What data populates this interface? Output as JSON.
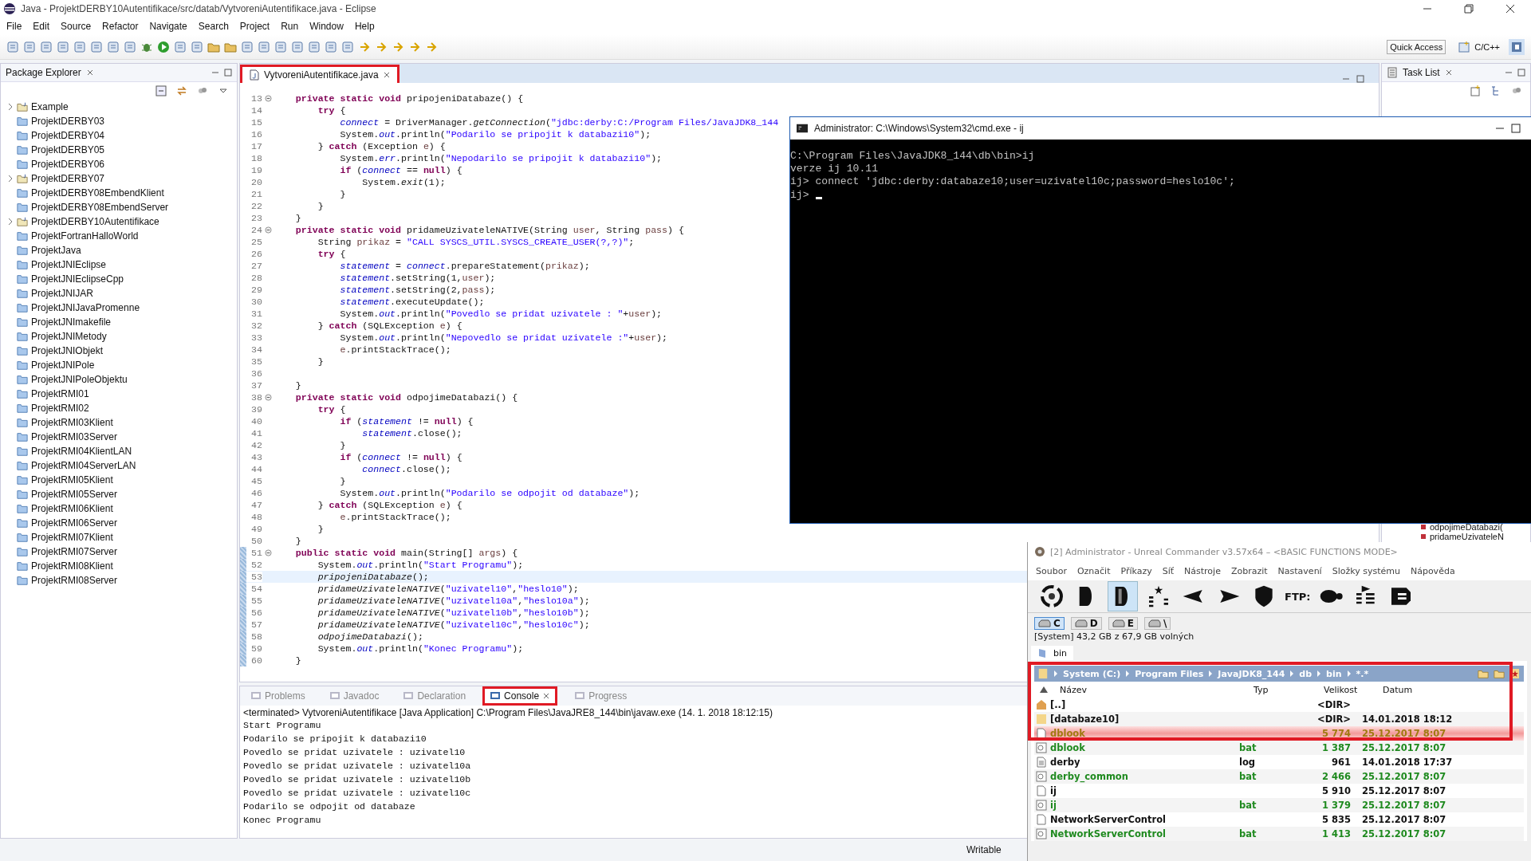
{
  "window": {
    "title": "Java - ProjektDERBY10Autentifikace/src/datab/VytvoreniAutentifikace.java - Eclipse"
  },
  "menu": [
    "File",
    "Edit",
    "Source",
    "Refactor",
    "Navigate",
    "Search",
    "Project",
    "Run",
    "Window",
    "Help"
  ],
  "toolbar": {
    "quick_access": "Quick Access",
    "perspective": "C/C++"
  },
  "package_explorer": {
    "title": "Package Explorer",
    "projects": [
      {
        "name": "Example",
        "kind": "java"
      },
      {
        "name": "ProjektDERBY03",
        "kind": "plain"
      },
      {
        "name": "ProjektDERBY04",
        "kind": "plain"
      },
      {
        "name": "ProjektDERBY05",
        "kind": "plain"
      },
      {
        "name": "ProjektDERBY06",
        "kind": "plain"
      },
      {
        "name": "ProjektDERBY07",
        "kind": "java"
      },
      {
        "name": "ProjektDERBY08EmbendKlient",
        "kind": "plain"
      },
      {
        "name": "ProjektDERBY08EmbendServer",
        "kind": "plain"
      },
      {
        "name": "ProjektDERBY10Autentifikace",
        "kind": "java"
      },
      {
        "name": "ProjektFortranHalloWorld",
        "kind": "plain"
      },
      {
        "name": "ProjektJava",
        "kind": "plain"
      },
      {
        "name": "ProjektJNIEclipse",
        "kind": "plain"
      },
      {
        "name": "ProjektJNIEclipseCpp",
        "kind": "plain"
      },
      {
        "name": "ProjektJNIJAR",
        "kind": "plain"
      },
      {
        "name": "ProjektJNIJavaPromenne",
        "kind": "plain"
      },
      {
        "name": "ProjektJNImakefile",
        "kind": "plain"
      },
      {
        "name": "ProjektJNIMetody",
        "kind": "plain"
      },
      {
        "name": "ProjektJNIObjekt",
        "kind": "plain"
      },
      {
        "name": "ProjektJNIPole",
        "kind": "plain"
      },
      {
        "name": "ProjektJNIPoleObjektu",
        "kind": "plain"
      },
      {
        "name": "ProjektRMI01",
        "kind": "plain"
      },
      {
        "name": "ProjektRMI02",
        "kind": "plain"
      },
      {
        "name": "ProjektRMI03Klient",
        "kind": "plain"
      },
      {
        "name": "ProjektRMI03Server",
        "kind": "plain"
      },
      {
        "name": "ProjektRMI04KlientLAN",
        "kind": "plain"
      },
      {
        "name": "ProjektRMI04ServerLAN",
        "kind": "plain"
      },
      {
        "name": "ProjektRMI05Klient",
        "kind": "plain"
      },
      {
        "name": "ProjektRMI05Server",
        "kind": "plain"
      },
      {
        "name": "ProjektRMI06Klient",
        "kind": "plain"
      },
      {
        "name": "ProjektRMI06Server",
        "kind": "plain"
      },
      {
        "name": "ProjektRMI07Klient",
        "kind": "plain"
      },
      {
        "name": "ProjektRMI07Server",
        "kind": "plain"
      },
      {
        "name": "ProjektRMI08Klient",
        "kind": "plain"
      },
      {
        "name": "ProjektRMI08Server",
        "kind": "plain"
      }
    ]
  },
  "editor": {
    "tab": {
      "label": "VytvoreniAutentifikace.java",
      "annotated": true
    },
    "lines": [
      {
        "no": "13",
        "fold": true,
        "changed": false,
        "current": false,
        "tokens": [
          {
            "kind": "k",
            "text": "    private static void"
          },
          {
            "kind": "p",
            "text": " pripojeniDatabaze() {"
          }
        ]
      },
      {
        "no": "14",
        "fold": false,
        "changed": false,
        "current": false,
        "tokens": [
          {
            "kind": "k",
            "text": "        try"
          },
          {
            "kind": "p",
            "text": " {"
          }
        ]
      },
      {
        "no": "15",
        "fold": false,
        "changed": false,
        "current": false,
        "tokens": [
          {
            "kind": "f",
            "text": "            connect"
          },
          {
            "kind": "p",
            "text": " = DriverManager."
          },
          {
            "kind": "i",
            "text": "getConnection"
          },
          {
            "kind": "p",
            "text": "("
          },
          {
            "kind": "s",
            "text": "\"jdbc:derby:C:/Program Files/JavaJDK8_144"
          }
        ]
      },
      {
        "no": "16",
        "fold": false,
        "changed": false,
        "current": false,
        "tokens": [
          {
            "kind": "p",
            "text": "            System."
          },
          {
            "kind": "f",
            "text": "out"
          },
          {
            "kind": "p",
            "text": ".println("
          },
          {
            "kind": "s",
            "text": "\"Podarilo se pripojit k databazi10\""
          },
          {
            "kind": "p",
            "text": ");"
          }
        ]
      },
      {
        "no": "17",
        "fold": false,
        "changed": false,
        "current": false,
        "tokens": [
          {
            "kind": "p",
            "text": "        } "
          },
          {
            "kind": "k",
            "text": "catch"
          },
          {
            "kind": "p",
            "text": " (Exception "
          },
          {
            "kind": "v",
            "text": "e"
          },
          {
            "kind": "p",
            "text": ") {"
          }
        ]
      },
      {
        "no": "18",
        "fold": false,
        "changed": false,
        "current": false,
        "tokens": [
          {
            "kind": "p",
            "text": "            System."
          },
          {
            "kind": "f",
            "text": "err"
          },
          {
            "kind": "p",
            "text": ".println("
          },
          {
            "kind": "s",
            "text": "\"Nepodarilo se pripojit k databazi10\""
          },
          {
            "kind": "p",
            "text": ");"
          }
        ]
      },
      {
        "no": "19",
        "fold": false,
        "changed": false,
        "current": false,
        "tokens": [
          {
            "kind": "k",
            "text": "            if"
          },
          {
            "kind": "p",
            "text": " ("
          },
          {
            "kind": "f",
            "text": "connect"
          },
          {
            "kind": "p",
            "text": " == "
          },
          {
            "kind": "k",
            "text": "null"
          },
          {
            "kind": "p",
            "text": ") {"
          }
        ]
      },
      {
        "no": "20",
        "fold": false,
        "changed": false,
        "current": false,
        "tokens": [
          {
            "kind": "p",
            "text": "                System."
          },
          {
            "kind": "i",
            "text": "exit"
          },
          {
            "kind": "p",
            "text": "(1);"
          }
        ]
      },
      {
        "no": "21",
        "fold": false,
        "changed": false,
        "current": false,
        "tokens": [
          {
            "kind": "p",
            "text": "            }"
          }
        ]
      },
      {
        "no": "22",
        "fold": false,
        "changed": false,
        "current": false,
        "tokens": [
          {
            "kind": "p",
            "text": "        }"
          }
        ]
      },
      {
        "no": "23",
        "fold": false,
        "changed": false,
        "current": false,
        "tokens": [
          {
            "kind": "p",
            "text": "    }"
          }
        ]
      },
      {
        "no": "24",
        "fold": true,
        "changed": false,
        "current": false,
        "tokens": [
          {
            "kind": "k",
            "text": "    private static void"
          },
          {
            "kind": "p",
            "text": " pridameUzivateleNATIVE(String "
          },
          {
            "kind": "v",
            "text": "user"
          },
          {
            "kind": "p",
            "text": ", String "
          },
          {
            "kind": "v",
            "text": "pass"
          },
          {
            "kind": "p",
            "text": ") {"
          }
        ]
      },
      {
        "no": "25",
        "fold": false,
        "changed": false,
        "current": false,
        "tokens": [
          {
            "kind": "p",
            "text": "        String "
          },
          {
            "kind": "v",
            "text": "prikaz"
          },
          {
            "kind": "p",
            "text": " = "
          },
          {
            "kind": "s",
            "text": "\"CALL SYSCS_UTIL.SYSCS_CREATE_USER(?,?)\""
          },
          {
            "kind": "p",
            "text": ";"
          }
        ]
      },
      {
        "no": "26",
        "fold": false,
        "changed": false,
        "current": false,
        "tokens": [
          {
            "kind": "k",
            "text": "        try"
          },
          {
            "kind": "p",
            "text": " {"
          }
        ]
      },
      {
        "no": "27",
        "fold": false,
        "changed": false,
        "current": false,
        "tokens": [
          {
            "kind": "f",
            "text": "            statement"
          },
          {
            "kind": "p",
            "text": " = "
          },
          {
            "kind": "f",
            "text": "connect"
          },
          {
            "kind": "p",
            "text": ".prepareStatement("
          },
          {
            "kind": "v",
            "text": "prikaz"
          },
          {
            "kind": "p",
            "text": ");"
          }
        ]
      },
      {
        "no": "28",
        "fold": false,
        "changed": false,
        "current": false,
        "tokens": [
          {
            "kind": "f",
            "text": "            statement"
          },
          {
            "kind": "p",
            "text": ".setString(1,"
          },
          {
            "kind": "v",
            "text": "user"
          },
          {
            "kind": "p",
            "text": ");"
          }
        ]
      },
      {
        "no": "29",
        "fold": false,
        "changed": false,
        "current": false,
        "tokens": [
          {
            "kind": "f",
            "text": "            statement"
          },
          {
            "kind": "p",
            "text": ".setString(2,"
          },
          {
            "kind": "v",
            "text": "pass"
          },
          {
            "kind": "p",
            "text": ");"
          }
        ]
      },
      {
        "no": "30",
        "fold": false,
        "changed": false,
        "current": false,
        "tokens": [
          {
            "kind": "f",
            "text": "            statement"
          },
          {
            "kind": "p",
            "text": ".executeUpdate();"
          }
        ]
      },
      {
        "no": "31",
        "fold": false,
        "changed": false,
        "current": false,
        "tokens": [
          {
            "kind": "p",
            "text": "            System."
          },
          {
            "kind": "f",
            "text": "out"
          },
          {
            "kind": "p",
            "text": ".println("
          },
          {
            "kind": "s",
            "text": "\"Povedlo se pridat uzivatele : \""
          },
          {
            "kind": "p",
            "text": "+"
          },
          {
            "kind": "v",
            "text": "user"
          },
          {
            "kind": "p",
            "text": ");"
          }
        ]
      },
      {
        "no": "32",
        "fold": false,
        "changed": false,
        "current": false,
        "tokens": [
          {
            "kind": "p",
            "text": "        } "
          },
          {
            "kind": "k",
            "text": "catch"
          },
          {
            "kind": "p",
            "text": " (SQLException "
          },
          {
            "kind": "v",
            "text": "e"
          },
          {
            "kind": "p",
            "text": ") {"
          }
        ]
      },
      {
        "no": "33",
        "fold": false,
        "changed": false,
        "current": false,
        "tokens": [
          {
            "kind": "p",
            "text": "            System."
          },
          {
            "kind": "f",
            "text": "out"
          },
          {
            "kind": "p",
            "text": ".println("
          },
          {
            "kind": "s",
            "text": "\"Nepovedlo se pridat uzivatele :\""
          },
          {
            "kind": "p",
            "text": "+"
          },
          {
            "kind": "v",
            "text": "user"
          },
          {
            "kind": "p",
            "text": ");"
          }
        ]
      },
      {
        "no": "34",
        "fold": false,
        "changed": false,
        "current": false,
        "tokens": [
          {
            "kind": "v",
            "text": "            e"
          },
          {
            "kind": "p",
            "text": ".printStackTrace();"
          }
        ]
      },
      {
        "no": "35",
        "fold": false,
        "changed": false,
        "current": false,
        "tokens": [
          {
            "kind": "p",
            "text": "        }"
          }
        ]
      },
      {
        "no": "36",
        "fold": false,
        "changed": false,
        "current": false
      },
      {
        "no": "37",
        "fold": false,
        "changed": false,
        "current": false,
        "tokens": [
          {
            "kind": "p",
            "text": "    }"
          }
        ]
      },
      {
        "no": "38",
        "fold": true,
        "changed": false,
        "current": false,
        "tokens": [
          {
            "kind": "k",
            "text": "    private static void"
          },
          {
            "kind": "p",
            "text": " odpojimeDatabazi() {"
          }
        ]
      },
      {
        "no": "39",
        "fold": false,
        "changed": false,
        "current": false,
        "tokens": [
          {
            "kind": "k",
            "text": "        try"
          },
          {
            "kind": "p",
            "text": " {"
          }
        ]
      },
      {
        "no": "40",
        "fold": false,
        "changed": false,
        "current": false,
        "tokens": [
          {
            "kind": "k",
            "text": "            if"
          },
          {
            "kind": "p",
            "text": " ("
          },
          {
            "kind": "f",
            "text": "statement"
          },
          {
            "kind": "p",
            "text": " != "
          },
          {
            "kind": "k",
            "text": "null"
          },
          {
            "kind": "p",
            "text": ") {"
          }
        ]
      },
      {
        "no": "41",
        "fold": false,
        "changed": false,
        "current": false,
        "tokens": [
          {
            "kind": "f",
            "text": "                statement"
          },
          {
            "kind": "p",
            "text": ".close();"
          }
        ]
      },
      {
        "no": "42",
        "fold": false,
        "changed": false,
        "current": false,
        "tokens": [
          {
            "kind": "p",
            "text": "            }"
          }
        ]
      },
      {
        "no": "43",
        "fold": false,
        "changed": false,
        "current": false,
        "tokens": [
          {
            "kind": "k",
            "text": "            if"
          },
          {
            "kind": "p",
            "text": " ("
          },
          {
            "kind": "f",
            "text": "connect"
          },
          {
            "kind": "p",
            "text": " != "
          },
          {
            "kind": "k",
            "text": "null"
          },
          {
            "kind": "p",
            "text": ") {"
          }
        ]
      },
      {
        "no": "44",
        "fold": false,
        "changed": false,
        "current": false,
        "tokens": [
          {
            "kind": "f",
            "text": "                connect"
          },
          {
            "kind": "p",
            "text": ".close();"
          }
        ]
      },
      {
        "no": "45",
        "fold": false,
        "changed": false,
        "current": false,
        "tokens": [
          {
            "kind": "p",
            "text": "            }"
          }
        ]
      },
      {
        "no": "46",
        "fold": false,
        "changed": false,
        "current": false,
        "tokens": [
          {
            "kind": "p",
            "text": "            System."
          },
          {
            "kind": "f",
            "text": "out"
          },
          {
            "kind": "p",
            "text": ".println("
          },
          {
            "kind": "s",
            "text": "\"Podarilo se odpojit od databaze\""
          },
          {
            "kind": "p",
            "text": ");"
          }
        ]
      },
      {
        "no": "47",
        "fold": false,
        "changed": false,
        "current": false,
        "tokens": [
          {
            "kind": "p",
            "text": "        } "
          },
          {
            "kind": "k",
            "text": "catch"
          },
          {
            "kind": "p",
            "text": " (SQLException "
          },
          {
            "kind": "v",
            "text": "e"
          },
          {
            "kind": "p",
            "text": ") {"
          }
        ]
      },
      {
        "no": "48",
        "fold": false,
        "changed": false,
        "current": false,
        "tokens": [
          {
            "kind": "v",
            "text": "            e"
          },
          {
            "kind": "p",
            "text": ".printStackTrace();"
          }
        ]
      },
      {
        "no": "49",
        "fold": false,
        "changed": false,
        "current": false,
        "tokens": [
          {
            "kind": "p",
            "text": "        }"
          }
        ]
      },
      {
        "no": "50",
        "fold": false,
        "changed": false,
        "current": false,
        "tokens": [
          {
            "kind": "p",
            "text": "    }"
          }
        ]
      },
      {
        "no": "51",
        "fold": true,
        "changed": true,
        "current": false,
        "tokens": [
          {
            "kind": "k",
            "text": "    public static void"
          },
          {
            "kind": "p",
            "text": " main(String[] "
          },
          {
            "kind": "v",
            "text": "args"
          },
          {
            "kind": "p",
            "text": ") {"
          }
        ]
      },
      {
        "no": "52",
        "fold": false,
        "changed": true,
        "current": false,
        "tokens": [
          {
            "kind": "p",
            "text": "        System."
          },
          {
            "kind": "f",
            "text": "out"
          },
          {
            "kind": "p",
            "text": ".println("
          },
          {
            "kind": "s",
            "text": "\"Start Programu\""
          },
          {
            "kind": "p",
            "text": ");"
          }
        ]
      },
      {
        "no": "53",
        "fold": false,
        "changed": true,
        "current": true,
        "tokens": [
          {
            "kind": "i",
            "text": "        pripojeniDatabaze"
          },
          {
            "kind": "p",
            "text": "();"
          }
        ]
      },
      {
        "no": "54",
        "fold": false,
        "changed": true,
        "current": false,
        "tokens": [
          {
            "kind": "i",
            "text": "        pridameUzivateleNATIVE"
          },
          {
            "kind": "p",
            "text": "("
          },
          {
            "kind": "s",
            "text": "\"uzivatel10\""
          },
          {
            "kind": "p",
            "text": ","
          },
          {
            "kind": "s",
            "text": "\"heslo10\""
          },
          {
            "kind": "p",
            "text": ");"
          }
        ]
      },
      {
        "no": "55",
        "fold": false,
        "changed": true,
        "current": false,
        "tokens": [
          {
            "kind": "i",
            "text": "        pridameUzivateleNATIVE"
          },
          {
            "kind": "p",
            "text": "("
          },
          {
            "kind": "s",
            "text": "\"uzivatel10a\""
          },
          {
            "kind": "p",
            "text": ","
          },
          {
            "kind": "s",
            "text": "\"heslo10a\""
          },
          {
            "kind": "p",
            "text": ");"
          }
        ]
      },
      {
        "no": "56",
        "fold": false,
        "changed": true,
        "current": false,
        "tokens": [
          {
            "kind": "i",
            "text": "        pridameUzivateleNATIVE"
          },
          {
            "kind": "p",
            "text": "("
          },
          {
            "kind": "s",
            "text": "\"uzivatel10b\""
          },
          {
            "kind": "p",
            "text": ","
          },
          {
            "kind": "s",
            "text": "\"heslo10b\""
          },
          {
            "kind": "p",
            "text": ");"
          }
        ]
      },
      {
        "no": "57",
        "fold": false,
        "changed": true,
        "current": false,
        "tokens": [
          {
            "kind": "i",
            "text": "        pridameUzivateleNATIVE"
          },
          {
            "kind": "p",
            "text": "("
          },
          {
            "kind": "s",
            "text": "\"uzivatel10c\""
          },
          {
            "kind": "p",
            "text": ","
          },
          {
            "kind": "s",
            "text": "\"heslo10c\""
          },
          {
            "kind": "p",
            "text": ");"
          }
        ]
      },
      {
        "no": "58",
        "fold": false,
        "changed": true,
        "current": false,
        "tokens": [
          {
            "kind": "i",
            "text": "        odpojimeDatabazi"
          },
          {
            "kind": "p",
            "text": "();"
          }
        ]
      },
      {
        "no": "59",
        "fold": false,
        "changed": true,
        "current": false,
        "tokens": [
          {
            "kind": "p",
            "text": "        System."
          },
          {
            "kind": "f",
            "text": "out"
          },
          {
            "kind": "p",
            "text": ".println("
          },
          {
            "kind": "s",
            "text": "\"Konec Programu\""
          },
          {
            "kind": "p",
            "text": ");"
          }
        ]
      },
      {
        "no": "60",
        "fold": false,
        "changed": true,
        "current": false,
        "tokens": [
          {
            "kind": "p",
            "text": "    }"
          }
        ]
      }
    ]
  },
  "task_list": {
    "title": "Task List",
    "outline": [
      "odpojimeDatabazi(",
      "pridameUzivateleN"
    ]
  },
  "bottom_panel": {
    "tabs": [
      {
        "label": "Problems",
        "selected": false,
        "annotated": false
      },
      {
        "label": "Javadoc",
        "selected": false,
        "annotated": false
      },
      {
        "label": "Declaration",
        "selected": false,
        "annotated": false
      },
      {
        "label": "Console",
        "selected": true,
        "annotated": true
      },
      {
        "label": "Progress",
        "selected": false,
        "annotated": false
      }
    ],
    "console_header": "<terminated> VytvoreniAutentifikace [Java Application] C:\\Program Files\\JavaJRE8_144\\bin\\javaw.exe (14. 1. 2018 18:12:15)",
    "console_lines": [
      "Start Programu",
      "Podarilo se pripojit k databazi10",
      "Povedlo se pridat uzivatele : uzivatel10",
      "Povedlo se pridat uzivatele : uzivatel10a",
      "Povedlo se pridat uzivatele : uzivatel10b",
      "Povedlo se pridat uzivatele : uzivatel10c",
      "Podarilo se odpojit od databaze",
      "Konec Programu"
    ]
  },
  "status_bar": {
    "mode": "Writable"
  },
  "cmd_window": {
    "title": "Administrator: C:\\Windows\\System32\\cmd.exe - ij",
    "lines": [
      "C:\\Program Files\\JavaJDK8_144\\db\\bin>ij",
      "verze ij 10.11",
      "ij> connect 'jdbc:derby:databaze10;user=uzivatel10c;password=heslo10c';",
      "ij>"
    ]
  },
  "commander": {
    "title": "[2] Administrator - Unreal Commander v3.57x64 – <BASIC FUNCTIONS MODE>",
    "menu": [
      "Soubor",
      "Označit",
      "Příkazy",
      "Síť",
      "Nástroje",
      "Zobrazit",
      "Nastavení",
      "Složky systému",
      "Nápověda"
    ],
    "ftp_label": "FTP:",
    "drives": [
      {
        "label": "C",
        "selected": true
      },
      {
        "label": "D",
        "selected": false
      },
      {
        "label": "E",
        "selected": false
      },
      {
        "label": "\\",
        "selected": false
      }
    ],
    "disk_info": "[System]  43,2 GB z  67,9 GB volných",
    "folder_tab": "bin",
    "path": [
      "System (C:)",
      "Program Files",
      "JavaJDK8_144",
      "db",
      "bin",
      "*.*"
    ],
    "annotated": true,
    "columns": [
      "Název",
      "Typ",
      "Velikost",
      "Datum"
    ],
    "files": [
      {
        "name": "[..]",
        "kind": "up",
        "size": "<DIR>",
        "selected": false
      },
      {
        "name": "[databaze10]",
        "kind": "dir",
        "size": "<DIR>",
        "date": "14.01.2018 18:12",
        "selected": false
      },
      {
        "name": "dblook",
        "kind": "file",
        "size": "5 774",
        "date": "25.12.2017 8:07",
        "selected": true
      },
      {
        "name": "dblook",
        "kind": "bat",
        "type": "bat",
        "size": "1 387",
        "date": "25.12.2017 8:07",
        "selected": false
      },
      {
        "name": "derby",
        "kind": "log",
        "type": "log",
        "size": "961",
        "date": "14.01.2018 17:37",
        "selected": false
      },
      {
        "name": "derby_common",
        "kind": "bat",
        "type": "bat",
        "size": "2 466",
        "date": "25.12.2017 8:07",
        "selected": false
      },
      {
        "name": "ij",
        "kind": "file",
        "size": "5 910",
        "date": "25.12.2017 8:07",
        "selected": false
      },
      {
        "name": "ij",
        "kind": "bat",
        "type": "bat",
        "size": "1 379",
        "date": "25.12.2017 8:07",
        "selected": false
      },
      {
        "name": "NetworkServerControl",
        "kind": "file",
        "size": "5 835",
        "date": "25.12.2017 8:07",
        "selected": false
      },
      {
        "name": "NetworkServerControl",
        "kind": "bat",
        "type": "bat",
        "size": "1 413",
        "date": "25.12.2017 8:07",
        "selected": false
      }
    ]
  }
}
